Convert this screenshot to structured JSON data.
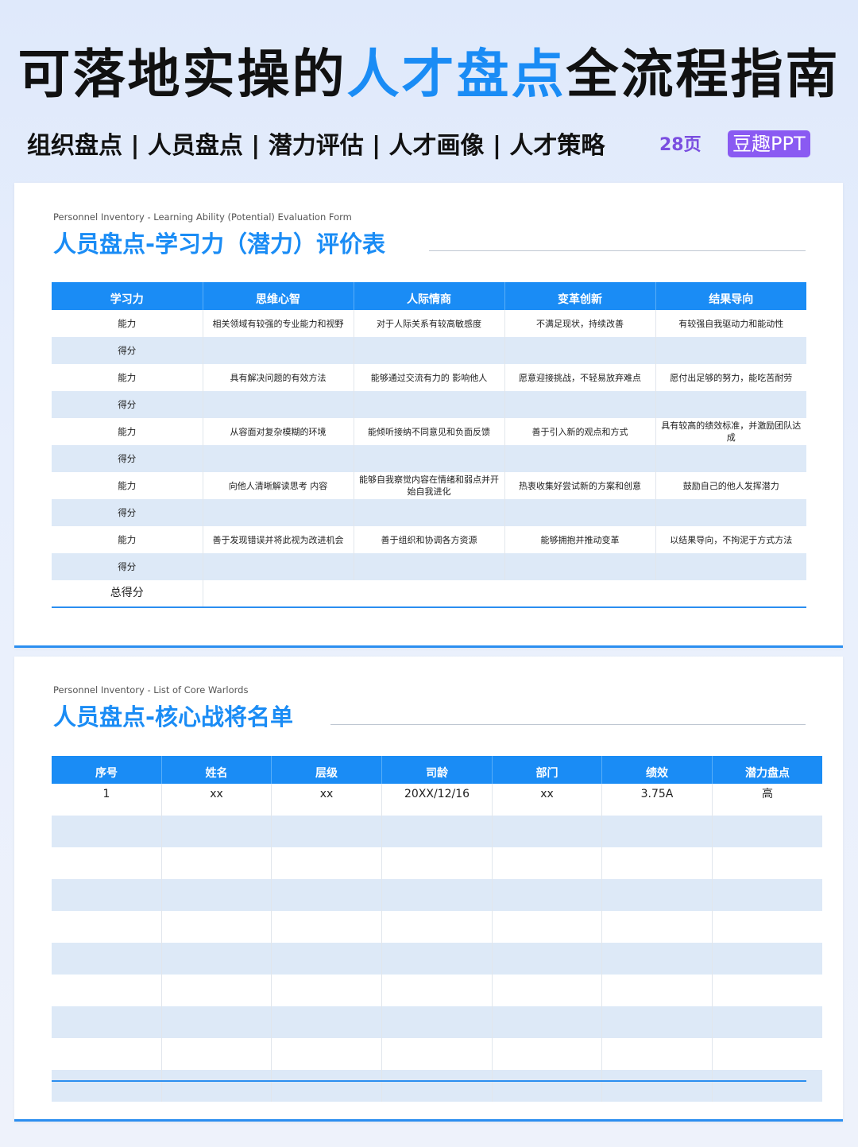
{
  "header": {
    "title_part1": "可落地实操的",
    "title_accent": "人才盘点",
    "title_part2": "全流程指南",
    "subtitle": "组织盘点 | 人员盘点 | 潜力评估 | 人才画像 | 人才策略",
    "pages": "28页",
    "brand": "豆趣PPT"
  },
  "slide1": {
    "eyebrow": "Personnel Inventory - Learning Ability (Potential) Evaluation Form",
    "title": "人员盘点-学习力（潜力）评价表",
    "columns": [
      "学习力",
      "思维心智",
      "人际情商",
      "变革创新",
      "结果导向"
    ],
    "ability_label": "能力",
    "score_label": "得分",
    "total_label": "总得分",
    "rows": [
      [
        "相关领域有较强的专业能力和视野",
        "对于人际关系有较高敏感度",
        "不满足现状，持续改善",
        "有较强自我驱动力和能动性"
      ],
      [
        "具有解决问题的有效方法",
        "能够通过交流有力的 影响他人",
        "愿意迎接挑战，不轻易放弃难点",
        "愿付出足够的努力，能吃苦耐劳"
      ],
      [
        "从容面对复杂模糊的环境",
        "能倾听接纳不同意见和负面反馈",
        "善于引入新的观点和方式",
        "具有较高的绩效标准，并激励团队达成"
      ],
      [
        "向他人清晰解读思考 内容",
        "能够自我察觉内容在情绪和弱点并开始自我进化",
        "热衷收集好尝试新的方案和创意",
        "鼓励自己的他人发挥潜力"
      ],
      [
        "善于发现错误并将此视为改进机会",
        "善于组织和协调各方资源",
        "能够拥抱并推动变革",
        "以结果导向，不拘泥于方式方法"
      ]
    ]
  },
  "slide2": {
    "eyebrow": "Personnel Inventory - List of Core Warlords",
    "title": "人员盘点-核心战将名单",
    "columns": [
      "序号",
      "姓名",
      "层级",
      "司龄",
      "部门",
      "绩效",
      "潜力盘点"
    ],
    "rows": [
      [
        "1",
        "xx",
        "xx",
        "20XX/12/16",
        "xx",
        "3.75A",
        "高"
      ]
    ]
  }
}
